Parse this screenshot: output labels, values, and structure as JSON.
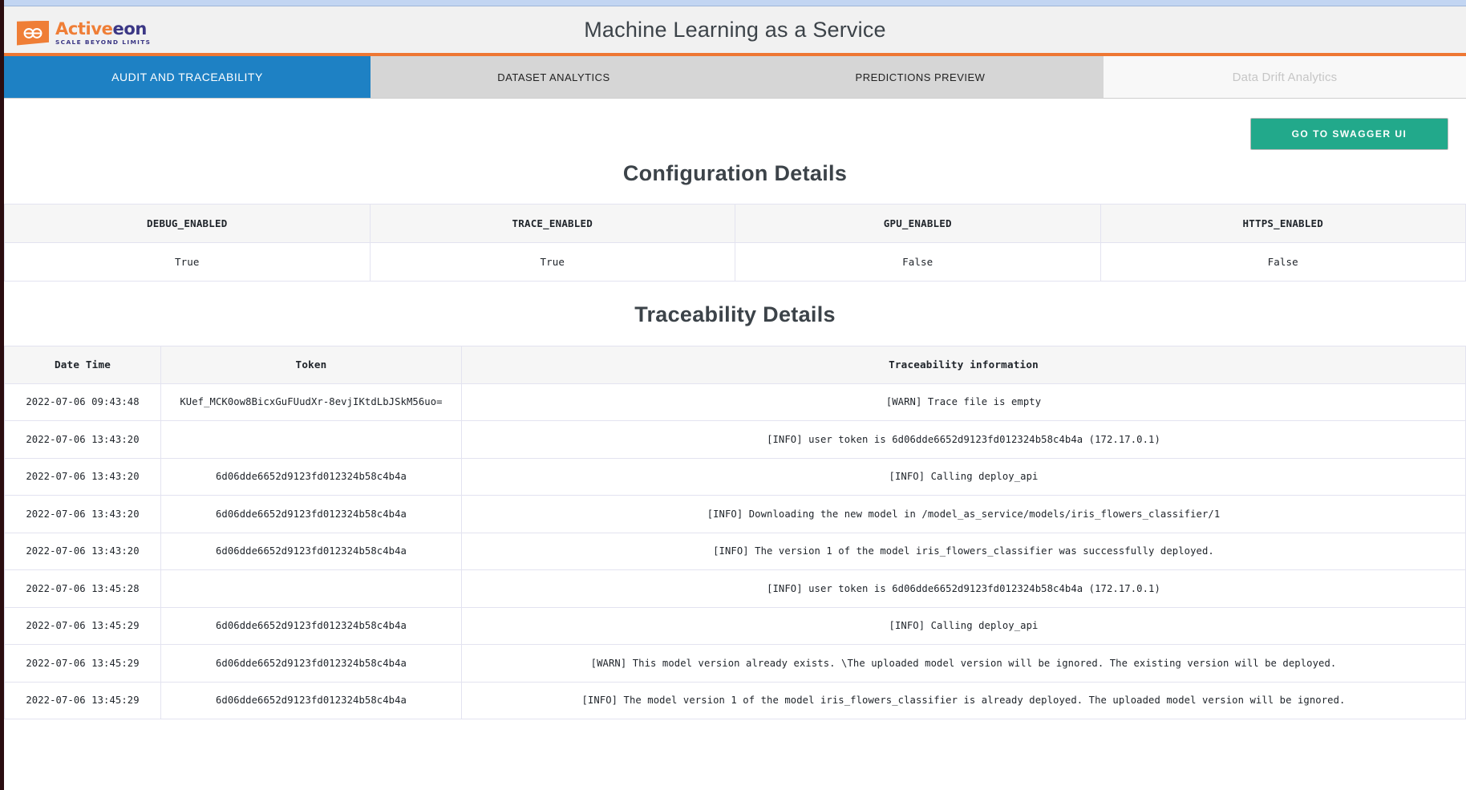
{
  "header": {
    "title": "Machine Learning as a Service",
    "logo": {
      "word_a": "Active",
      "word_b": "eon",
      "tagline": "SCALE BEYOND LIMITS"
    }
  },
  "tabs": [
    {
      "label": "AUDIT AND TRACEABILITY",
      "state": "active"
    },
    {
      "label": "DATASET ANALYTICS",
      "state": "idle"
    },
    {
      "label": "PREDICTIONS PREVIEW",
      "state": "idle"
    },
    {
      "label": "Data Drift Analytics",
      "state": "disabled"
    }
  ],
  "toolbar": {
    "swagger_label": "GO TO SWAGGER UI"
  },
  "configuration": {
    "title": "Configuration Details",
    "columns": [
      "DEBUG_ENABLED",
      "TRACE_ENABLED",
      "GPU_ENABLED",
      "HTTPS_ENABLED"
    ],
    "rows": [
      [
        "True",
        "True",
        "False",
        "False"
      ]
    ]
  },
  "traceability": {
    "title": "Traceability Details",
    "columns": [
      "Date Time",
      "Token",
      "Traceability information"
    ],
    "rows": [
      [
        "2022-07-06 09:43:48",
        "KUef_MCK0ow8BicxGuFUudXr-8evjIKtdLbJSkM56uo=",
        "[WARN] Trace file is empty"
      ],
      [
        "2022-07-06 13:43:20",
        "",
        "[INFO] user token is 6d06dde6652d9123fd012324b58c4b4a (172.17.0.1)"
      ],
      [
        "2022-07-06 13:43:20",
        "6d06dde6652d9123fd012324b58c4b4a",
        "[INFO] Calling deploy_api"
      ],
      [
        "2022-07-06 13:43:20",
        "6d06dde6652d9123fd012324b58c4b4a",
        "[INFO] Downloading the new model in /model_as_service/models/iris_flowers_classifier/1"
      ],
      [
        "2022-07-06 13:43:20",
        "6d06dde6652d9123fd012324b58c4b4a",
        "[INFO] The version 1 of the model iris_flowers_classifier was successfully deployed."
      ],
      [
        "2022-07-06 13:45:28",
        "",
        "[INFO] user token is 6d06dde6652d9123fd012324b58c4b4a (172.17.0.1)"
      ],
      [
        "2022-07-06 13:45:29",
        "6d06dde6652d9123fd012324b58c4b4a",
        "[INFO] Calling deploy_api"
      ],
      [
        "2022-07-06 13:45:29",
        "6d06dde6652d9123fd012324b58c4b4a",
        "[WARN] This model version already exists. \\The uploaded model version will be ignored. The existing version will be deployed."
      ],
      [
        "2022-07-06 13:45:29",
        "6d06dde6652d9123fd012324b58c4b4a",
        "[INFO] The model version 1 of the model iris_flowers_classifier is already deployed. The uploaded model version will be ignored."
      ]
    ]
  },
  "colors": {
    "accent_orange": "#ee7733",
    "active_tab_blue": "#1e81c4",
    "swagger_green": "#22a98b",
    "brand_purple": "#3b3785"
  }
}
